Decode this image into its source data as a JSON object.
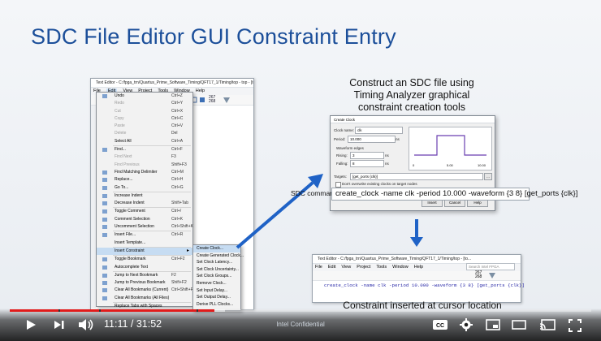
{
  "slide": {
    "title": "SDC File Editor GUI Constraint Entry",
    "note_top": "Construct an SDC file using Timing Analyzer graphical constraint creation tools",
    "note_bottom": "Constraint inserted at cursor location",
    "footer": "Intel Confidential"
  },
  "editor_left": {
    "title": "Text Editor - C:/fpga_trn/Quartus_Prime_Software_Timing/QFT17_1/Timing/top - top - [top.sdc]",
    "menus": [
      "File",
      "Edit",
      "View",
      "Project",
      "Tools",
      "Window",
      "Help"
    ],
    "selected_menu": "Edit",
    "toolbar_digits": [
      "267",
      "268"
    ],
    "edit_menu": [
      {
        "label": "Undo",
        "shortcut": "Ctrl+Z",
        "dim": false
      },
      {
        "label": "Redo",
        "shortcut": "Ctrl+Y",
        "dim": true
      },
      {
        "label": "Cut",
        "shortcut": "Ctrl+X",
        "dim": true
      },
      {
        "label": "Copy",
        "shortcut": "Ctrl+C",
        "dim": true
      },
      {
        "label": "Paste",
        "shortcut": "Ctrl+V",
        "dim": true
      },
      {
        "label": "Delete",
        "shortcut": "Del",
        "dim": true
      },
      {
        "label": "Select All",
        "shortcut": "Ctrl+A",
        "dim": false
      },
      {
        "label": "Find...",
        "shortcut": "Ctrl+F",
        "dim": false
      },
      {
        "label": "Find Next",
        "shortcut": "F3",
        "dim": true
      },
      {
        "label": "Find Previous",
        "shortcut": "Shift+F3",
        "dim": true
      },
      {
        "label": "Find Matching Delimiter",
        "shortcut": "Ctrl+M",
        "dim": false
      },
      {
        "label": "Replace...",
        "shortcut": "Ctrl+H",
        "dim": false
      },
      {
        "label": "Go To...",
        "shortcut": "Ctrl+G",
        "dim": false
      },
      {
        "label": "Increase Indent",
        "shortcut": "",
        "dim": false
      },
      {
        "label": "Decrease Indent",
        "shortcut": "Shift+Tab",
        "dim": false
      },
      {
        "label": "Toggle Comment",
        "shortcut": "Ctrl+/",
        "dim": false
      },
      {
        "label": "Comment Selection",
        "shortcut": "Ctrl+K",
        "dim": false
      },
      {
        "label": "Uncomment Selection",
        "shortcut": "Ctrl+Shift+K",
        "dim": false
      },
      {
        "label": "Insert File...",
        "shortcut": "Ctrl+R",
        "dim": false
      },
      {
        "label": "Insert Template...",
        "shortcut": "",
        "dim": false
      },
      {
        "label": "Insert Constraint",
        "shortcut": "",
        "dim": false
      },
      {
        "label": "Toggle Bookmark",
        "shortcut": "Ctrl+F2",
        "dim": false
      },
      {
        "label": "Autocomplete Text",
        "shortcut": "",
        "dim": false
      },
      {
        "label": "Jump to Next Bookmark",
        "shortcut": "F2",
        "dim": false
      },
      {
        "label": "Jump to Previous Bookmark",
        "shortcut": "Shift+F2",
        "dim": false
      },
      {
        "label": "Clear All Bookmarks (Current)",
        "shortcut": "Ctrl+Shift+F2",
        "dim": false
      },
      {
        "label": "Clear All Bookmarks (All Files)",
        "shortcut": "",
        "dim": false
      },
      {
        "label": "Replace Tabs with Spaces",
        "shortcut": "",
        "dim": false
      }
    ],
    "submenu": [
      "Create Clock...",
      "Create Generated Clock...",
      "Set Clock Latency...",
      "Set Clock Uncertainty...",
      "Set Clock Groups...",
      "Remove Clock...",
      "Set Input Delay...",
      "Set Output Delay...",
      "Derive PLL Clocks..."
    ]
  },
  "dialog": {
    "title": "Create Clock",
    "clock_name_label": "Clock name:",
    "clock_name": "clk",
    "period_label": "Period:",
    "period": "10.000",
    "period_unit": "ns",
    "waveform_label": "Waveform edges",
    "rising_label": "Rising:",
    "rising": "3",
    "falling_label": "Falling:",
    "falling": "8",
    "edge_unit": "ns",
    "wave_ticks": [
      "0",
      "5.00",
      "10.00"
    ],
    "targets_label": "Targets:",
    "targets": "[get_ports {clk}]",
    "overwrite_label": "Don't overwrite existing clocks on target nodes",
    "sdc_command_label": "SDC command:",
    "sdc_command": "create_clock -name clk -period 10.000 -waveform {3 8} [get_ports {clk}]",
    "buttons": [
      "Insert",
      "Cancel",
      "Help"
    ]
  },
  "editor_right": {
    "title": "Text Editor - C:/fpga_trn/Quartus_Prime_Software_Timing/QFT17_1/Timing/top - [to...",
    "menus": [
      "File",
      "Edit",
      "View",
      "Project",
      "Tools",
      "Window",
      "Help"
    ],
    "search_placeholder": "Search Intel FPGA",
    "toolbar_digits": [
      "267",
      "268"
    ],
    "code_line": "create_clock -name clk -period 10.000 -waveform {3 8} [get_ports {clk}]"
  },
  "player": {
    "time": "11:11 / 31:52",
    "progress": 0.352,
    "buffered": 0.37
  }
}
